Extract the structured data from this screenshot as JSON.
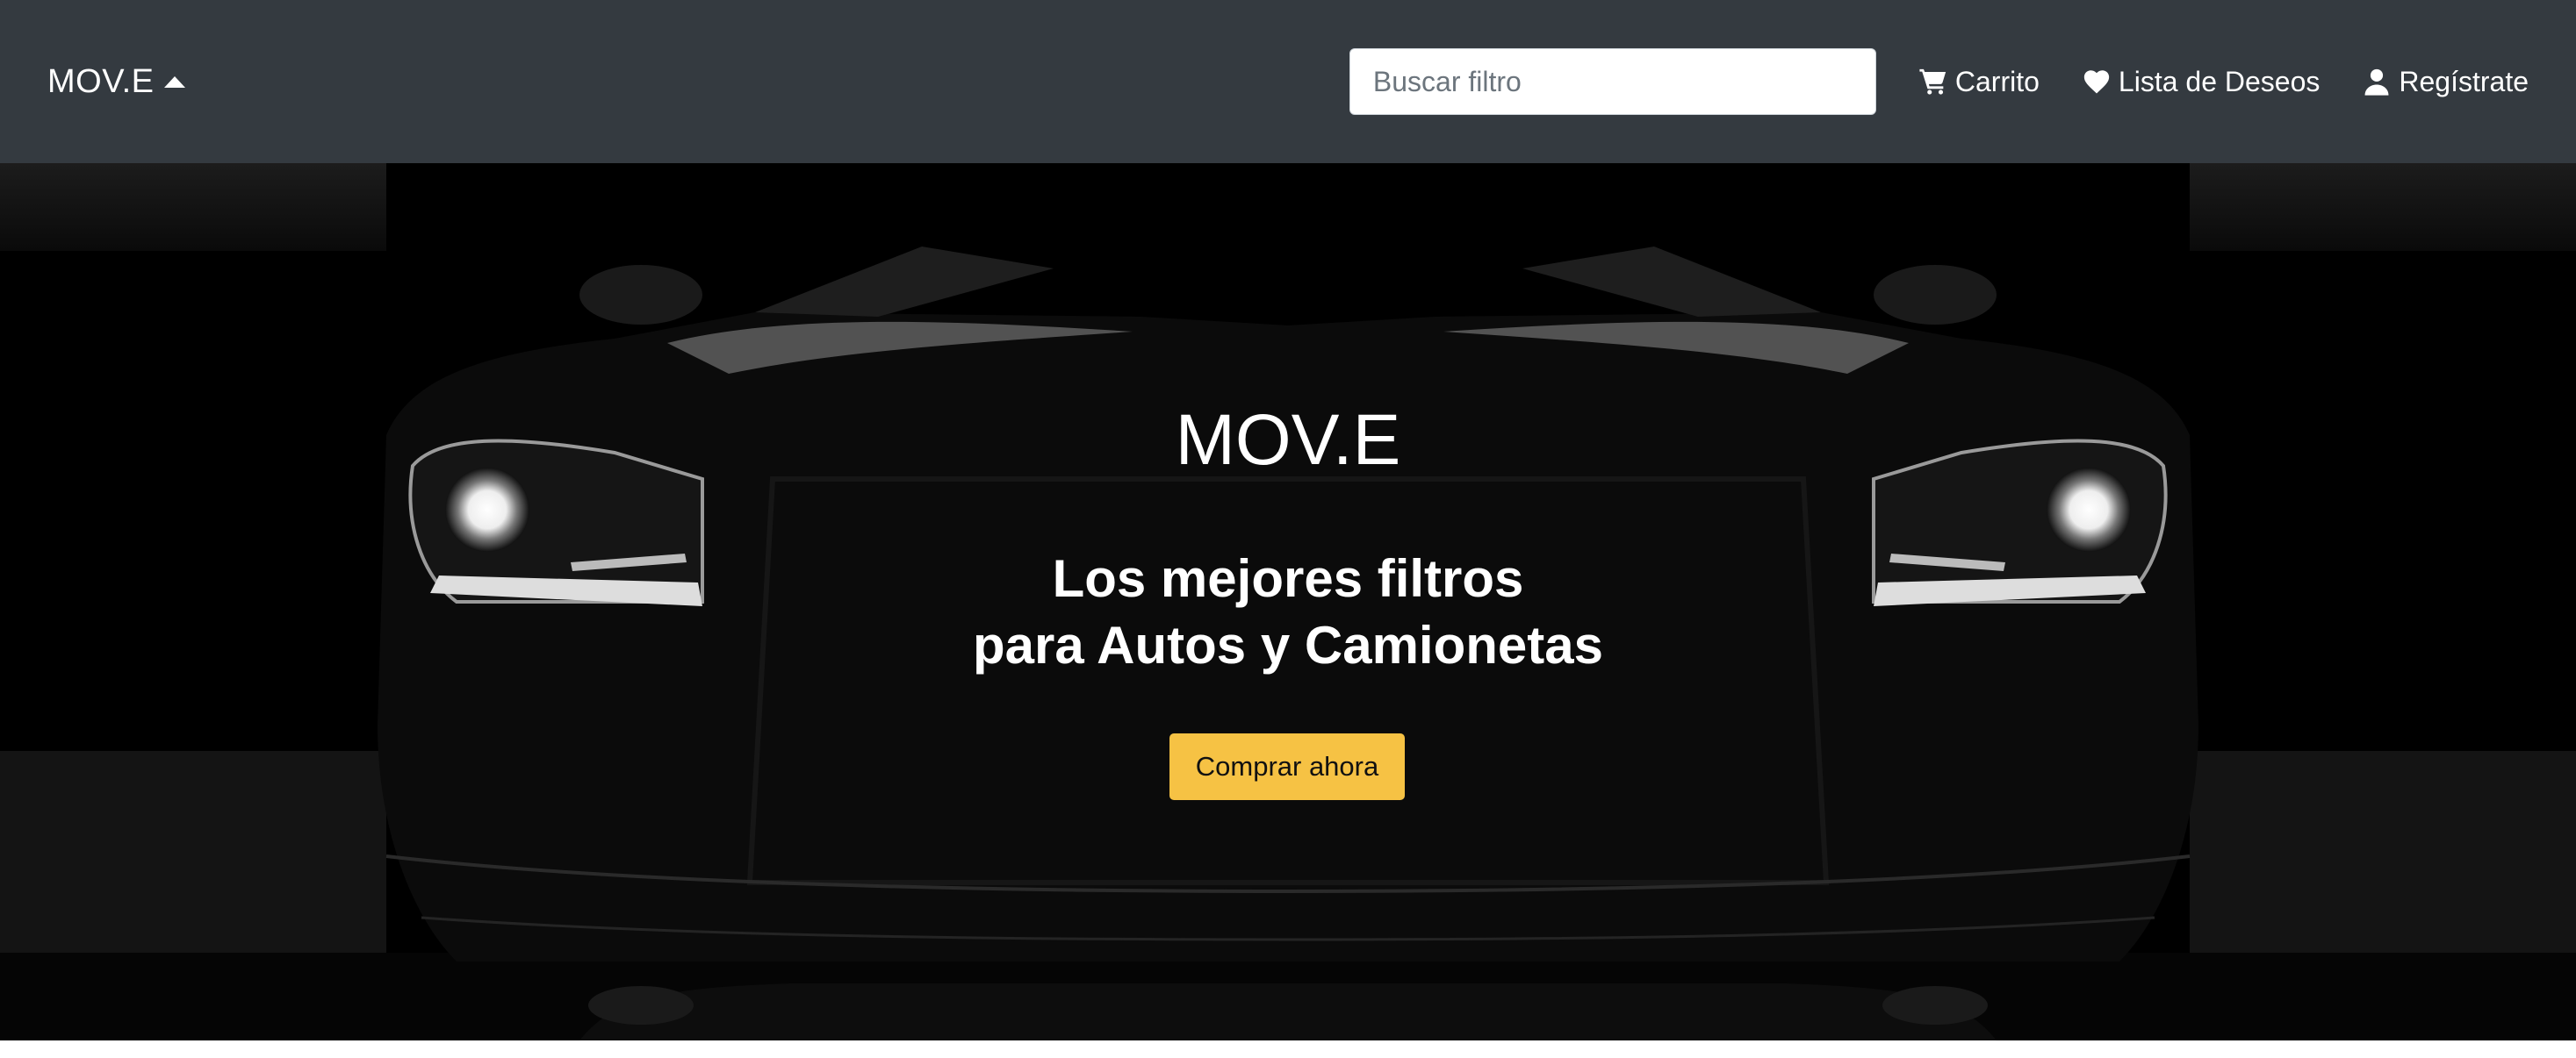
{
  "navbar": {
    "brand": "MOV.E",
    "brand_icon": "caret-up-icon",
    "search": {
      "placeholder": "Buscar filtro",
      "value": ""
    },
    "links": [
      {
        "label": "Carrito",
        "icon": "cart-icon"
      },
      {
        "label": "Lista de Deseos",
        "icon": "heart-icon"
      },
      {
        "label": "Regístrate",
        "icon": "user-icon"
      }
    ],
    "background": "#343a40"
  },
  "hero": {
    "title": "MOV.E",
    "subtitle_line1": "Los mejores filtros",
    "subtitle_line2": "para Autos y Camionetas",
    "cta_label": "Comprar ahora",
    "cta_color": "#f6c244",
    "background_image": "black car front"
  }
}
